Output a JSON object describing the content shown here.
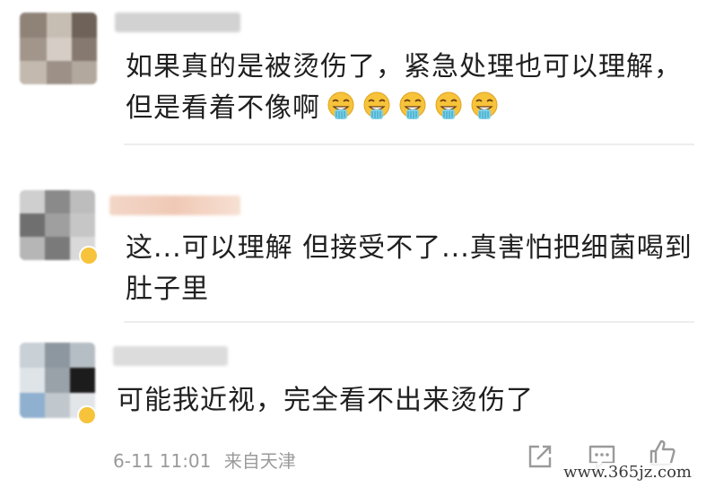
{
  "comments": [
    {
      "text_lines": [
        "如果真的是被烫伤了，紧急处理也可以理解，",
        "但是看着不像啊"
      ],
      "emoji_count": 5,
      "emoji_name": "vomit-emoji"
    },
    {
      "text_lines": [
        "这...可以理解 但接受不了...真害怕把细菌喝到",
        "肚子里"
      ]
    },
    {
      "text_lines": [
        "可能我近视，完全看不出来烫伤了"
      ],
      "timestamp": "6-11 11:01",
      "source": "来自天津"
    }
  ],
  "actions": [
    {
      "icon": "share-icon"
    },
    {
      "icon": "comment-icon"
    },
    {
      "icon": "like-icon"
    }
  ],
  "watermark": "www.365jz.com",
  "colors": {
    "text": "#1f1f1f",
    "meta": "#9a9a9a",
    "divider": "#ededed",
    "badge": "#f6c33b"
  }
}
